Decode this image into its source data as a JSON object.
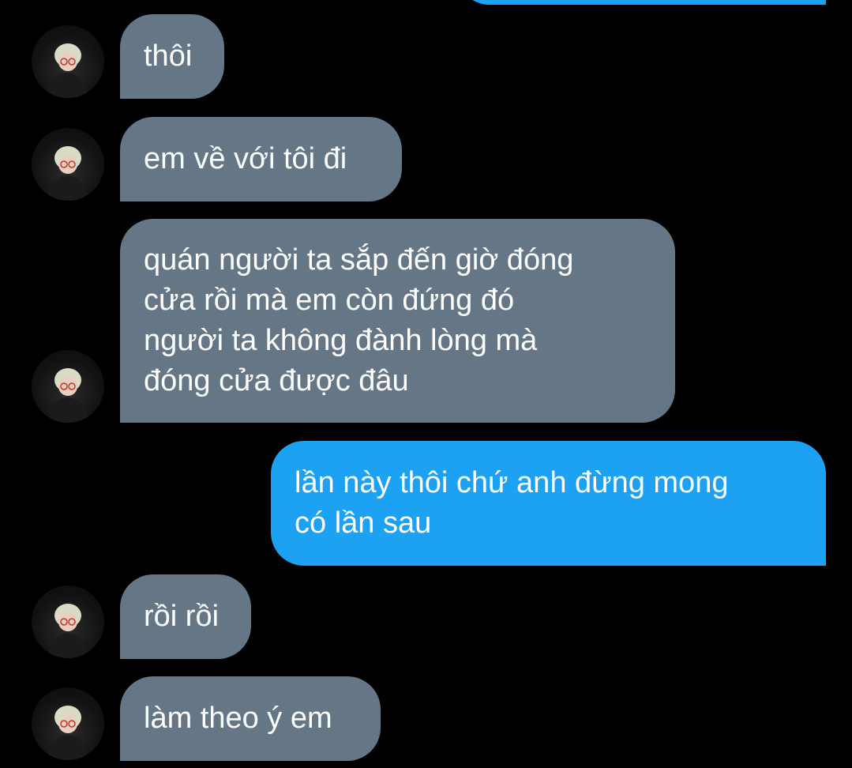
{
  "messages": [
    {
      "direction": "incoming",
      "text": "thôi"
    },
    {
      "direction": "incoming",
      "text": "em về với tôi đi"
    },
    {
      "direction": "incoming",
      "text": "quán người ta sắp đến giờ đóng\ncửa rồi mà em còn đứng đó\nngười ta không đành lòng mà\nđóng cửa được đâu"
    },
    {
      "direction": "outgoing",
      "text": "lần này thôi chứ anh đừng mong\ncó lần sau"
    },
    {
      "direction": "incoming",
      "text": "rồi rồi"
    },
    {
      "direction": "incoming",
      "text": "làm theo ý em"
    }
  ],
  "colors": {
    "background": "#000000",
    "incoming_bubble": "#657786",
    "outgoing_bubble": "#1da1f2",
    "text": "#ffffff"
  },
  "icons": {
    "avatar": "profile-avatar-icon"
  }
}
